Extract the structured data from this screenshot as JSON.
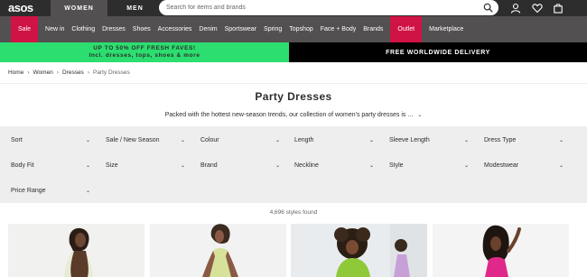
{
  "header": {
    "logo": "asos",
    "gender_tabs": [
      "WOMEN",
      "MEN"
    ],
    "active_gender": "WOMEN",
    "search_placeholder": "Search for items and brands",
    "icons": [
      "search-icon",
      "account-icon",
      "heart-icon",
      "bag-icon"
    ]
  },
  "nav": {
    "categories": [
      "Sale",
      "New in",
      "Clothing",
      "Dresses",
      "Shoes",
      "Accessories",
      "Denim",
      "Sportswear",
      "Spring",
      "Topshop",
      "Face + Body",
      "Brands",
      "Outlet",
      "Marketplace"
    ],
    "highlight_color": "#d01345"
  },
  "promo": {
    "left_line1": "UP TO 50% OFF FRESH FAVES!",
    "left_line2": "Incl. dresses, tops, shoes & more",
    "right": "FREE WORLDWIDE DELIVERY"
  },
  "breadcrumb": [
    "Home",
    "Women",
    "Dresses",
    "Party Dresses"
  ],
  "page": {
    "title": "Party Dresses",
    "description": "Packed with the hottest new-season trends, our collection of women's party dresses is ..."
  },
  "filters": [
    "Sort",
    "Sale / New Season",
    "Colour",
    "Length",
    "Sleeve Length",
    "Dress Type",
    "Body Fit",
    "Size",
    "Brand",
    "Neckline",
    "Style",
    "Modestwear",
    "Price Range"
  ],
  "results": {
    "count_text": "4,696 styles found"
  },
  "colors": {
    "header_bg": "#2d2d2d",
    "nav_bg": "#525050",
    "sale": "#d01345",
    "promo_green": "#2cde6f",
    "filter_bg": "#eeeeee"
  }
}
